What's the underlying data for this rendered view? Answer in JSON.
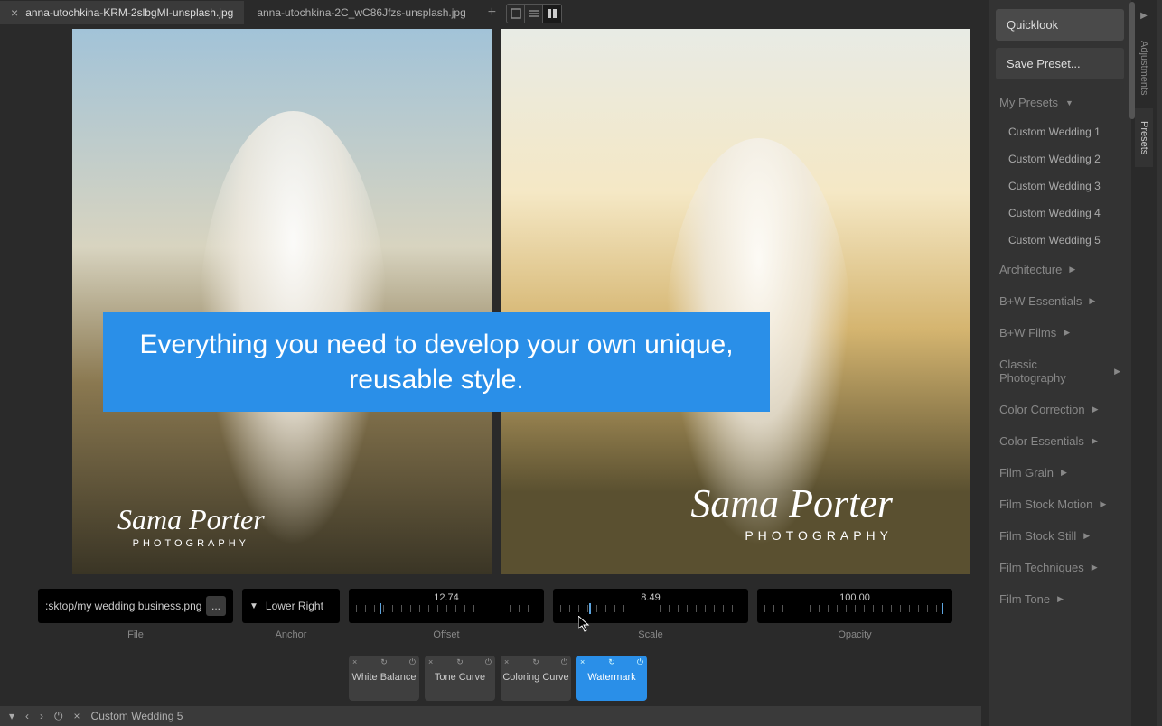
{
  "tabs": [
    {
      "label": "anna-utochkina-KRM-2slbgMI-unsplash.jpg",
      "active": true
    },
    {
      "label": "anna-utochkina-2C_wC86Jfzs-unsplash.jpg",
      "active": false
    }
  ],
  "overlay_text": "Everything you need to develop your own unique, reusable style.",
  "watermark": {
    "name": "Sama Porter",
    "sub": "PHOTOGRAPHY"
  },
  "file": {
    "path": ":sktop/my wedding business.png",
    "browse": "..."
  },
  "anchor": {
    "value": "Lower Right"
  },
  "sliders": {
    "offset": {
      "value": "12.74",
      "pos": 13
    },
    "scale": {
      "value": "8.49",
      "pos": 16
    },
    "opacity": {
      "value": "100.00",
      "pos": 100
    }
  },
  "control_labels": {
    "file": "File",
    "anchor": "Anchor",
    "offset": "Offset",
    "scale": "Scale",
    "opacity": "Opacity"
  },
  "adjustments": [
    {
      "label": "White Balance",
      "active": false
    },
    {
      "label": "Tone Curve",
      "active": false
    },
    {
      "label": "Coloring Curve",
      "active": false
    },
    {
      "label": "Watermark",
      "active": true
    }
  ],
  "bottom_preset": "Custom Wedding 5",
  "sidebar": {
    "quicklook": "Quicklook",
    "save_preset": "Save Preset...",
    "my_presets": "My Presets",
    "presets": [
      "Custom Wedding 1",
      "Custom Wedding 2",
      "Custom Wedding 3",
      "Custom Wedding 4",
      "Custom Wedding 5"
    ],
    "categories": [
      "Architecture",
      "B+W Essentials",
      "B+W Films",
      "Classic Photography",
      "Color Correction",
      "Color Essentials",
      "Film Grain",
      "Film Stock Motion",
      "Film Stock Still",
      "Film Techniques",
      "Film Tone"
    ],
    "tabs": {
      "adjustments": "Adjustments",
      "presets": "Presets"
    }
  }
}
